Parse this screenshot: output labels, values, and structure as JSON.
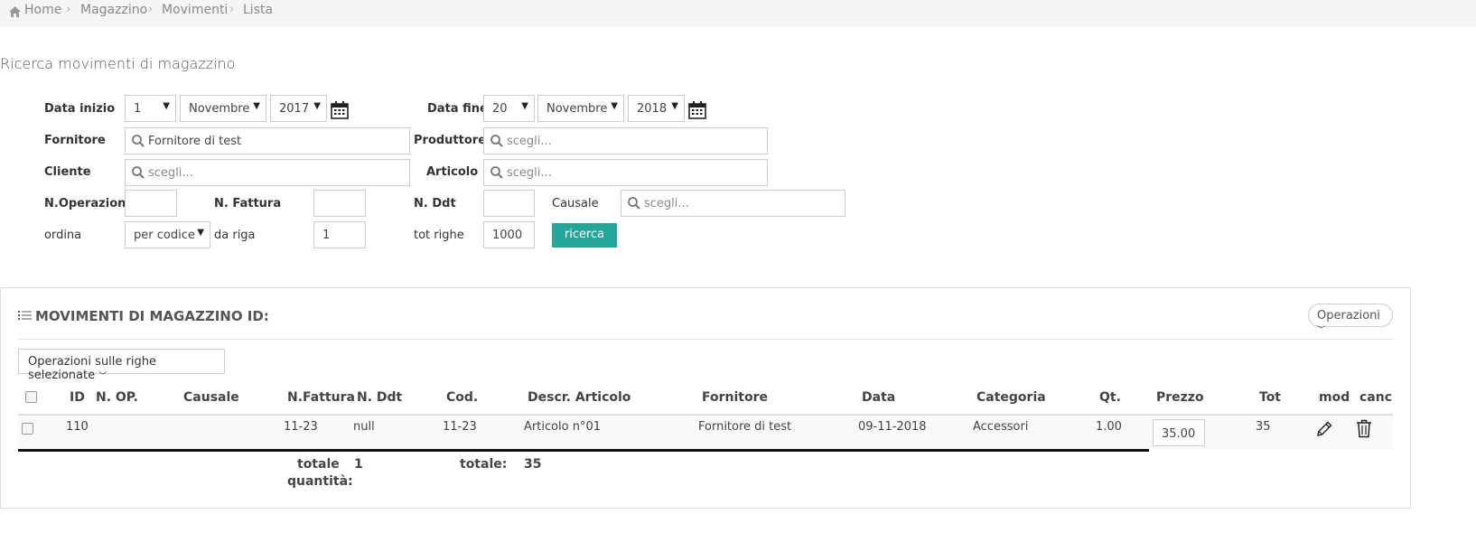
{
  "breadcrumb": {
    "home": "Home",
    "magazzino": "Magazzino",
    "movimenti": "Movimenti",
    "lista": "Lista"
  },
  "page_title": "Ricerca movimenti di magazzino",
  "form": {
    "data_inizio": {
      "label": "Data inizio",
      "day": "1",
      "month": "Novembre",
      "year": "2017"
    },
    "data_fine": {
      "label": "Data fine",
      "day": "20",
      "month": "Novembre",
      "year": "2018"
    },
    "fornitore": {
      "label": "Fornitore",
      "value": "Fornitore di test"
    },
    "produttore": {
      "label": "Produttore",
      "placeholder": "scegli..."
    },
    "cliente": {
      "label": "Cliente",
      "placeholder": "scegli..."
    },
    "articolo": {
      "label": "Articolo",
      "placeholder": "scegli..."
    },
    "n_operazione": {
      "label": "N.Operazione",
      "value": ""
    },
    "n_fattura": {
      "label": "N. Fattura",
      "value": ""
    },
    "n_ddt": {
      "label": "N. Ddt",
      "value": ""
    },
    "causale": {
      "label": "Causale",
      "placeholder": "scegli..."
    },
    "ordina": {
      "label": "ordina",
      "value": "per codice"
    },
    "da_riga": {
      "label": "da riga",
      "value": "1"
    },
    "tot_righe": {
      "label": "tot righe",
      "value": "1000"
    },
    "search_button": "ricerca"
  },
  "panel": {
    "title": "MOVIMENTI DI MAGAZZINO ID:",
    "operations_button": "Operazioni",
    "selected_ops_button": "Operazioni sulle righe selezionate"
  },
  "table": {
    "headers": [
      "ID",
      "N. OP.",
      "Causale",
      "N.Fattura",
      "N. Ddt",
      "Cod.",
      "Descr. Articolo",
      "Fornitore",
      "Data",
      "Categoria",
      "Qt.",
      "Prezzo",
      "Tot",
      "mod",
      "canc"
    ],
    "rows": [
      {
        "id": "110",
        "n_op": "",
        "causale": "",
        "n_fattura": "11-23",
        "n_ddt": "null",
        "cod": "11-23",
        "descr": "Articolo n°01",
        "fornitore": "Fornitore di test",
        "data": "09-11-2018",
        "categoria": "Accessori",
        "qt": "1.00",
        "prezzo": "35.00",
        "tot": "35"
      }
    ],
    "totals": {
      "qty_label_1": "totale",
      "qty_label_2": "quantità:",
      "qty_value": "1",
      "total_label": "totale:",
      "total_value": "35"
    }
  },
  "icons": {
    "home": "home-icon",
    "calendar": "calendar-icon",
    "search": "search-icon",
    "list": "list-icon",
    "edit": "pencil-icon",
    "delete": "trash-icon"
  },
  "colors": {
    "accent": "#26a69a",
    "breadcrumb_bg": "#f5f5f5"
  }
}
